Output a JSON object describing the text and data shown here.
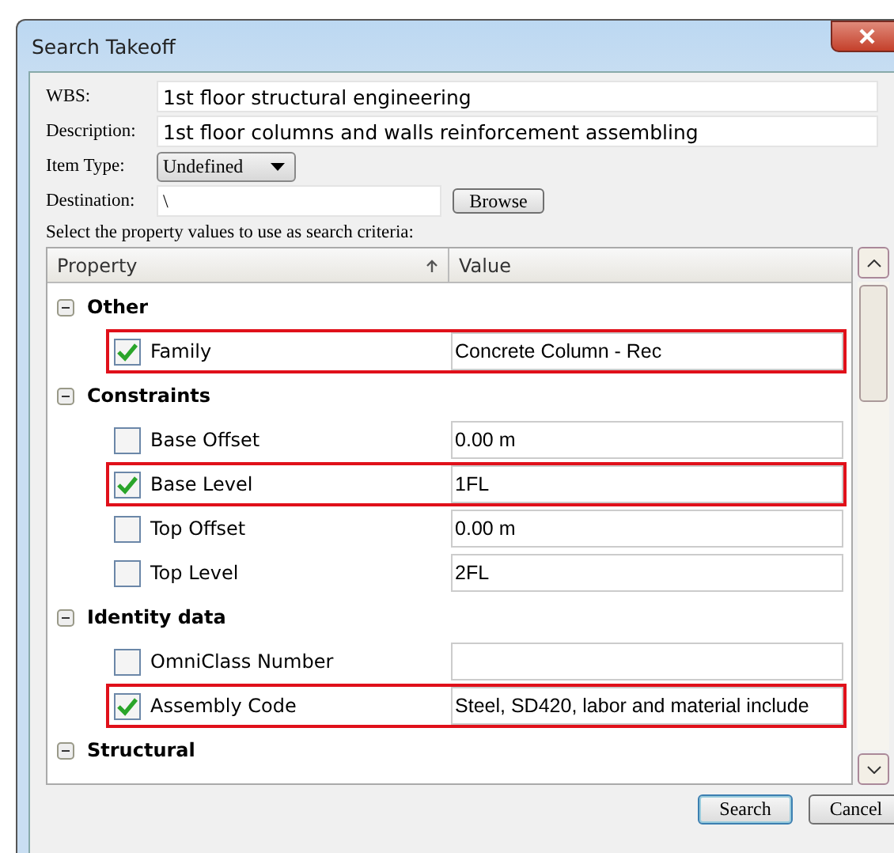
{
  "window": {
    "title": "Search Takeoff"
  },
  "form": {
    "wbs_label": "WBS:",
    "wbs": "1st floor structural engineering",
    "description_label": "Description:",
    "description": "1st floor columns and walls reinforcement assembling",
    "item_type_label": "Item Type:",
    "item_type": "Undefined",
    "destination_label": "Destination:",
    "destination": "\\",
    "browse": "Browse",
    "instruction": "Select the property values to use as search criteria:"
  },
  "grid": {
    "columns": [
      "Property",
      "Value"
    ],
    "groups": [
      {
        "name": "Other",
        "expanded": true,
        "properties": [
          {
            "name": "Family",
            "value": "Concrete Column - Rec",
            "checked": true,
            "highlighted": true
          }
        ]
      },
      {
        "name": "Constraints",
        "expanded": true,
        "properties": [
          {
            "name": "Base Offset",
            "value": "0.00 m",
            "checked": false,
            "highlighted": false
          },
          {
            "name": "Base Level",
            "value": "1FL",
            "checked": true,
            "highlighted": true
          },
          {
            "name": "Top Offset",
            "value": "0.00 m",
            "checked": false,
            "highlighted": false
          },
          {
            "name": "Top Level",
            "value": "2FL",
            "checked": false,
            "highlighted": false
          }
        ]
      },
      {
        "name": "Identity data",
        "expanded": true,
        "properties": [
          {
            "name": "OmniClass Number",
            "checked": false,
            "highlighted": false
          },
          {
            "name": "Assembly Code",
            "value": "Steel, SD420, labor and material include",
            "checked": true,
            "highlighted": true
          }
        ]
      },
      {
        "name": "Structural",
        "expanded": true
      }
    ]
  },
  "buttons": [
    {
      "label": "Search",
      "default": true
    },
    {
      "label": "Cancel",
      "default": false
    }
  ]
}
